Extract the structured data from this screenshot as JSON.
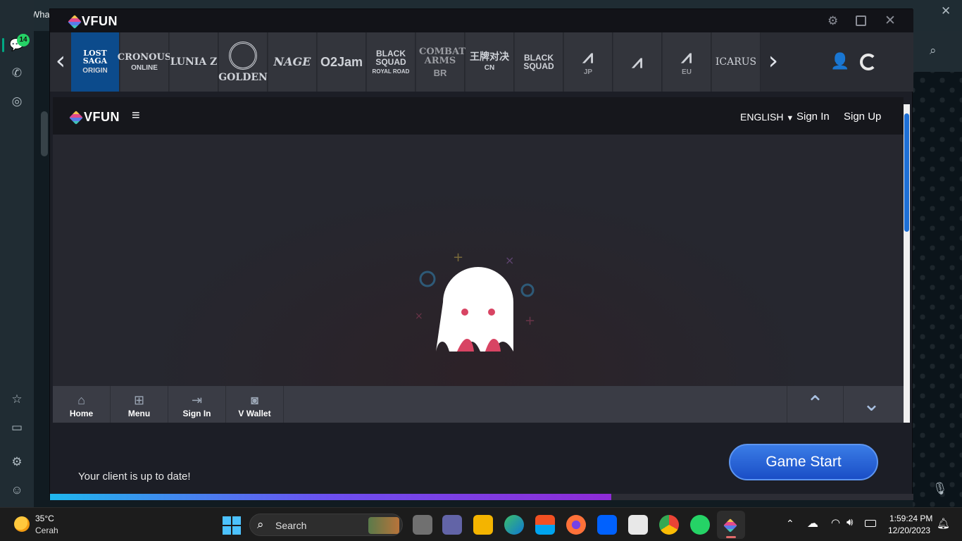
{
  "whatsapp": {
    "app_title": "Wha",
    "unread_badge": "14"
  },
  "vfun": {
    "title_logo": "VFUN",
    "games": [
      {
        "label": "LOST SAGA",
        "sub": "ORIGIN"
      },
      {
        "label": "CRONOUS",
        "sub": "ONLINE"
      },
      {
        "label": "LUNIA Z",
        "sub": ""
      },
      {
        "label": "GOLDEN",
        "sub": ""
      },
      {
        "label": "NAGE",
        "sub": ""
      },
      {
        "label": "O2Jam",
        "sub": ""
      },
      {
        "label": "BLACK SQUAD",
        "sub": "ROYAL ROAD"
      },
      {
        "label": "COMBAT ARMS",
        "sub": "BR"
      },
      {
        "label": "王牌对决",
        "sub": "CN"
      },
      {
        "label": "BLACK SQUAD",
        "sub": ""
      },
      {
        "label": "",
        "sub": "JP"
      },
      {
        "label": "",
        "sub": ""
      },
      {
        "label": "",
        "sub": "EU"
      },
      {
        "label": "ICARUS",
        "sub": ""
      }
    ],
    "web": {
      "logo": "VFUN",
      "language": "ENGLISH",
      "sign_in": "Sign In",
      "sign_up": "Sign Up"
    },
    "bottom_nav": [
      {
        "label": "Home"
      },
      {
        "label": "Menu"
      },
      {
        "label": "Sign In"
      },
      {
        "label": "V Wallet"
      }
    ],
    "status_text": "Your client is up to date!",
    "game_start": "Game Start",
    "progress_fraction": 0.65
  },
  "taskbar": {
    "weather_temp": "35°C",
    "weather_desc": "Cerah",
    "search_label": "Search",
    "time": "1:59:24 PM",
    "date": "12/20/2023"
  }
}
